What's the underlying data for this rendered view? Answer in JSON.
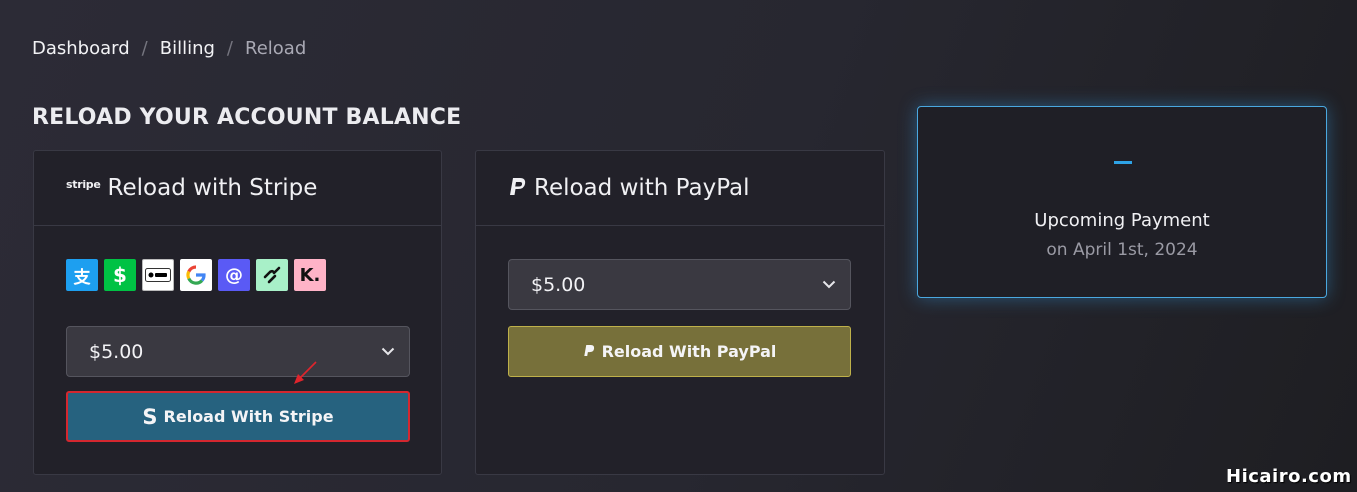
{
  "breadcrumb": {
    "items": [
      "Dashboard",
      "Billing",
      "Reload"
    ],
    "separator": "/"
  },
  "section_title": "RELOAD YOUR ACCOUNT BALANCE",
  "stripe_card": {
    "brand_word": "stripe",
    "title": "Reload with Stripe",
    "payment_icons": [
      "alipay-icon",
      "cash-app-icon",
      "apple-pay-icon",
      "google-pay-icon",
      "affirm-icon",
      "link-icon",
      "klarna-icon"
    ],
    "amount_select": "$5.00",
    "button_label": "Reload With Stripe",
    "button_icon": "S"
  },
  "paypal_card": {
    "title": "Reload with PayPal",
    "amount_select": "$5.00",
    "button_label": "Reload With PayPal"
  },
  "upcoming": {
    "value": "–",
    "label": "Upcoming Payment",
    "date": "on April 1st, 2024"
  },
  "watermark": "Hicairo.com",
  "colors": {
    "stripe_button": "#26627f",
    "paypal_button": "#77703a",
    "highlight_border": "#d4272f",
    "accent_blue": "#2ea3e6"
  }
}
